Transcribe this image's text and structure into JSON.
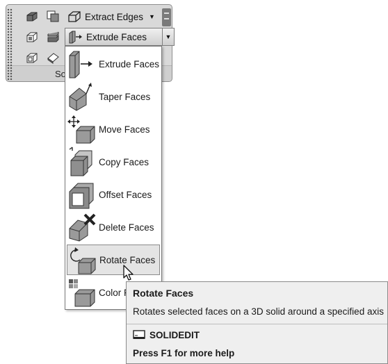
{
  "ribbon": {
    "extract_edges": {
      "label": "Extract Edges",
      "icon": "extract-edges-icon"
    },
    "extrude_faces": {
      "label": "Extrude Faces",
      "icon": "extrude-faces-icon"
    },
    "panel_footer_label": "So",
    "small_icons": [
      "solid-union-icon",
      "solid-subtract-icon",
      "shell-icon",
      "slice-icon",
      "imprint-icon",
      "clean-icon"
    ]
  },
  "menu": {
    "items": [
      {
        "label": "Extrude Faces",
        "icon": "extrude-faces-icon"
      },
      {
        "label": "Taper Faces",
        "icon": "taper-faces-icon"
      },
      {
        "label": "Move Faces",
        "icon": "move-faces-icon"
      },
      {
        "label": "Copy Faces",
        "icon": "copy-faces-icon"
      },
      {
        "label": "Offset Faces",
        "icon": "offset-faces-icon"
      },
      {
        "label": "Delete Faces",
        "icon": "delete-faces-icon"
      },
      {
        "label": "Rotate Faces",
        "icon": "rotate-faces-icon"
      },
      {
        "label": "Color F",
        "icon": "color-faces-icon"
      }
    ],
    "selected_index": 6
  },
  "tooltip": {
    "title": "Rotate Faces",
    "description": "Rotates selected faces on a 3D solid around a specified axis",
    "command": "SOLIDEDIT",
    "help": "Press F1 for more help"
  }
}
